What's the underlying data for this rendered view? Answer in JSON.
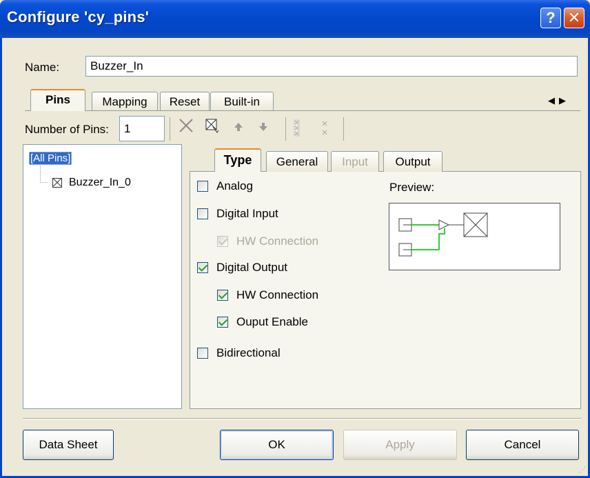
{
  "window": {
    "title": "Configure 'cy_pins'",
    "help_label": "?",
    "close_label": "✕"
  },
  "name": {
    "label": "Name:",
    "value": "Buzzer_In"
  },
  "outer_tabs": [
    "Pins",
    "Mapping",
    "Reset",
    "Built-in"
  ],
  "outer_tabs_active": "Pins",
  "tab_scroll": {
    "left": "◀",
    "right": "▶"
  },
  "pins": {
    "label": "Number of Pins:",
    "value": "1"
  },
  "toolbar_icons": [
    "delete-icon",
    "add-pin-icon",
    "move-up-icon",
    "move-down-icon",
    "split-icon",
    "merge-icon"
  ],
  "tree": {
    "root": "[All Pins]",
    "items": [
      "Buzzer_In_0"
    ]
  },
  "inner_tabs": [
    "Type",
    "General",
    "Input",
    "Output"
  ],
  "inner_tabs_active": "Type",
  "inner_tabs_disabled": [
    "Input"
  ],
  "options": [
    {
      "label": "Analog",
      "checked": false,
      "disabled": false
    },
    {
      "label": "Digital Input",
      "checked": false,
      "disabled": false
    },
    {
      "label": "HW Connection",
      "checked": true,
      "disabled": true
    },
    {
      "label": "Digital Output",
      "checked": true,
      "disabled": false
    },
    {
      "label": "HW Connection",
      "checked": true,
      "disabled": false
    },
    {
      "label": "Ouput Enable",
      "checked": true,
      "disabled": false
    },
    {
      "label": "Bidirectional",
      "checked": false,
      "disabled": false
    }
  ],
  "preview": {
    "label": "Preview:"
  },
  "buttons": {
    "datasheet": "Data Sheet",
    "ok": "OK",
    "apply": "Apply",
    "cancel": "Cancel"
  },
  "colors": {
    "title_bar": "#0348cc",
    "tab_accent": "#e68b2c",
    "preview_wire": "#33cc33",
    "check": "#21a121"
  }
}
